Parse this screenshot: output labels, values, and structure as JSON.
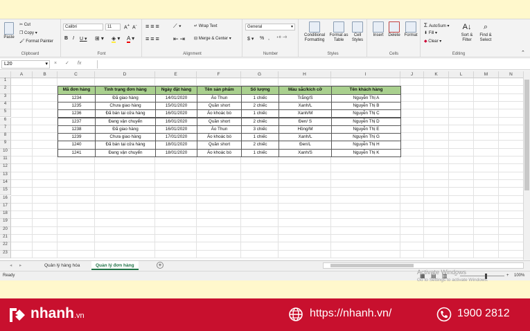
{
  "ribbon": {
    "clipboard": {
      "paste": "Paste",
      "cut": "Cut",
      "copy": "Copy",
      "format_painter": "Format Painter",
      "label": "Clipboard"
    },
    "font": {
      "name": "Calibri",
      "size": "11",
      "label": "Font",
      "bold": "B",
      "italic": "I",
      "underline": "U"
    },
    "alignment": {
      "wrap_text": "Wrap Text",
      "merge_center": "Merge & Center",
      "label": "Alignment"
    },
    "number": {
      "format": "General",
      "currency": "$",
      "percent": "%",
      "comma": ",",
      "label": "Number"
    },
    "styles": {
      "conditional": "Conditional\nFormatting",
      "format_table": "Format as\nTable",
      "cell_styles": "Cell\nStyles",
      "label": "Styles"
    },
    "cells": {
      "insert": "Insert",
      "delete": "Delete",
      "format": "Format",
      "label": "Cells"
    },
    "editing": {
      "autosum": "AutoSum",
      "fill": "Fill",
      "clear": "Clear",
      "sort": "Sort &\nFilter",
      "find": "Find &\nSelect",
      "label": "Editing"
    }
  },
  "formula_bar": {
    "name_box": "L20",
    "fx": "fx",
    "cancel": "×",
    "enter": "✓"
  },
  "columns": [
    "A",
    "B",
    "C",
    "D",
    "E",
    "F",
    "G",
    "H",
    "I",
    "J",
    "K",
    "L",
    "M",
    "N"
  ],
  "rows": [
    "1",
    "2",
    "3",
    "4",
    "5",
    "6",
    "7",
    "8",
    "9",
    "10",
    "11",
    "12",
    "13",
    "14",
    "15",
    "16",
    "17",
    "18",
    "19",
    "20",
    "21",
    "22",
    "23"
  ],
  "table": {
    "headers": [
      "Mã đơn hàng",
      "Tình trạng đơn hàng",
      "Ngày đặt hàng",
      "Tên sản phẩm",
      "Số lượng",
      "Màu sắc/kích cỡ",
      "Tên khách hàng"
    ],
    "rows": [
      [
        "1234",
        "Đã giao hàng",
        "14/01/2020",
        "Áo Thun",
        "1 chiếc",
        "Trắng/S",
        "Nguyễn Thị A"
      ],
      [
        "1235",
        "Chưa giao hàng",
        "15/01/2020",
        "Quần short",
        "2 chiếc",
        "Xanh/L",
        "Nguyễn Thị B"
      ],
      [
        "1236",
        "Đã bán tại cửa hàng",
        "16/01/2020",
        "Áo khoác bò",
        "1 chiếc",
        "Xanh/M",
        "Nguyễn Thị C"
      ],
      [
        "1237",
        "Đang vận chuyển",
        "16/01/2020",
        "Quần short",
        "2 chiếc",
        "Đen/ S",
        "Nguyễn Thị D"
      ],
      [
        "1238",
        "Đã giao hàng",
        "16/01/2020",
        "Áo Thun",
        "3 chiếc",
        "Hồng/M",
        "Nguyễn Thị E"
      ],
      [
        "1239",
        "Chưa giao hàng",
        "17/01/2020",
        "Áo khoác bò",
        "1 chiếc",
        "Xanh/L",
        "Nguyễn Thị G"
      ],
      [
        "1240",
        "Đã bán tại cửa hàng",
        "18/01/2020",
        "Quần short",
        "2 chiếc",
        "Đen/L",
        "Nguyễn Thị H"
      ],
      [
        "1241",
        "Đang vận chuyển",
        "18/01/2020",
        "Áo khoác bò",
        "1 chiếc",
        "Xanh/S",
        "Nguyễn Thị K"
      ]
    ]
  },
  "sheets": {
    "tab1": "Quản lý hàng hóa",
    "tab2": "Quản lý đơn hàng",
    "add": "+"
  },
  "status": {
    "ready": "Ready",
    "zoom": "100%"
  },
  "watermark": {
    "title": "Activate Windows",
    "sub": "Go to Settings to activate Windows."
  },
  "footer": {
    "brand": "nhanh",
    "brand_suffix": ".vn",
    "url": "https://nhanh.vn/",
    "phone": "1900 2812"
  },
  "colors": {
    "header_fill": "#a9d08e",
    "excel_green": "#1e7145",
    "footer_red": "#c8102e",
    "background": "#fff8cc"
  }
}
